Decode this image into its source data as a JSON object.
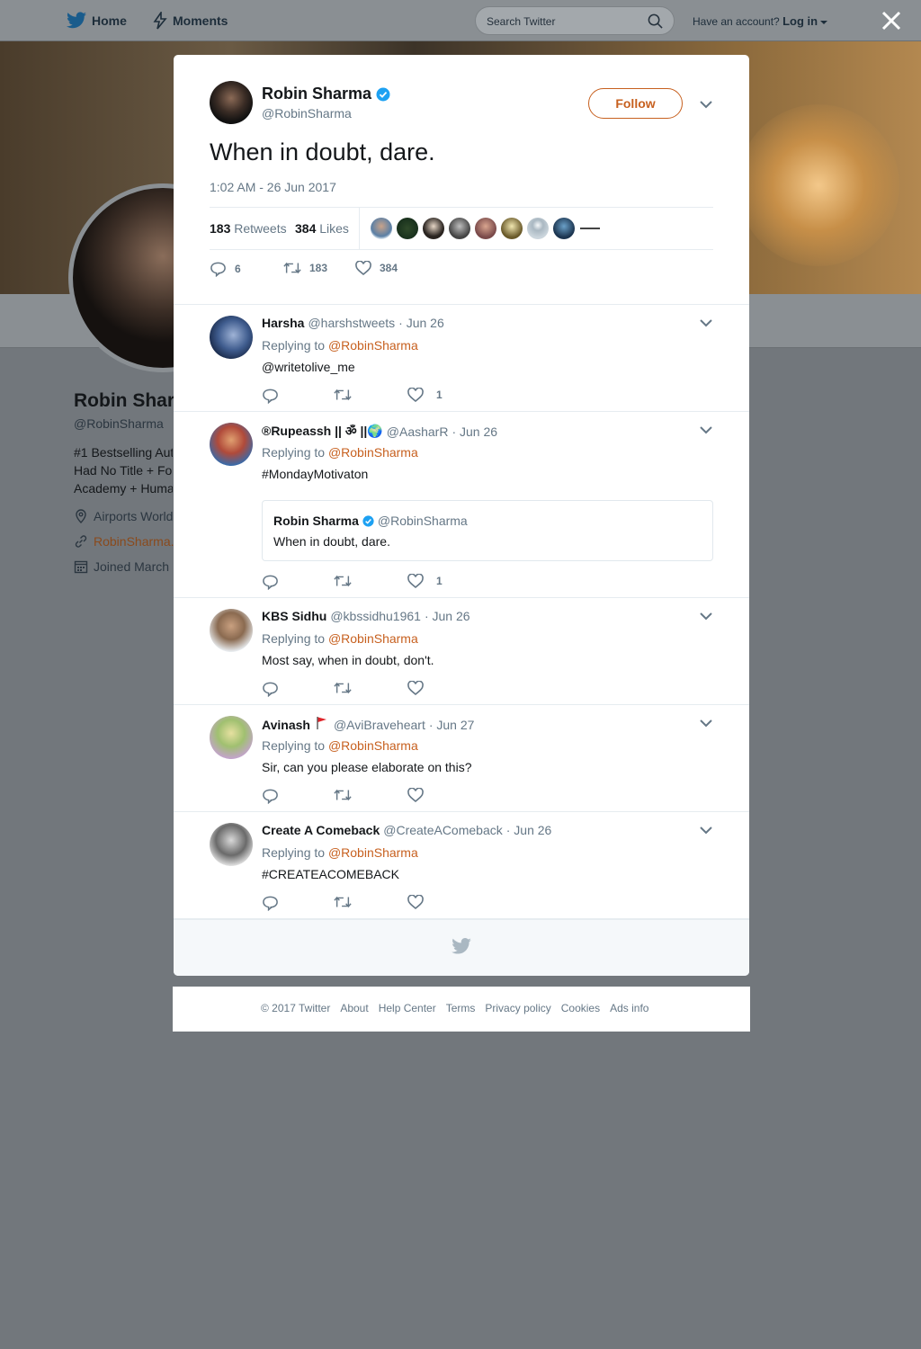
{
  "nav": {
    "home_label": "Home",
    "moments_label": "Moments",
    "search_placeholder": "Search Twitter",
    "have_account": "Have an account?",
    "login_label": "Log in"
  },
  "profile": {
    "name": "Robin Shar",
    "handle": "@RobinSharma",
    "bio_lines": [
      "#1 Bestselling Aut",
      "Had No Title + Fo",
      "Academy + Huma"
    ],
    "location": "Airports World",
    "website": "RobinSharma.",
    "joined": "Joined March"
  },
  "tweet": {
    "author_name": "Robin Sharma",
    "author_handle": "@RobinSharma",
    "follow_label": "Follow",
    "text": "When in doubt, dare.",
    "timestamp": "1:02 AM - 26 Jun 2017",
    "retweets_count": "183",
    "retweets_label": "Retweets",
    "likes_count": "384",
    "likes_label": "Likes",
    "reply_count": "6",
    "retweet_action_count": "183",
    "like_action_count": "384"
  },
  "replies": [
    {
      "name": "Harsha",
      "handle": "@harshstweets",
      "date": "· Jun 26",
      "replying_prefix": "Replying to",
      "replying_to": "@RobinSharma",
      "text": "@writetolive_me",
      "likes": "1"
    },
    {
      "name": "®Rupeassh || ॐ ||🌍",
      "handle": "@AasharR",
      "date": "· Jun 26",
      "replying_prefix": "Replying to",
      "replying_to": "@RobinSharma",
      "text": "#MondayMotivaton",
      "likes": "1",
      "quote": {
        "name": "Robin Sharma",
        "handle": "@RobinSharma",
        "text": "When in doubt, dare."
      }
    },
    {
      "name": "KBS Sidhu",
      "handle": "@kbssidhu1961",
      "date": "· Jun 26",
      "replying_prefix": "Replying to",
      "replying_to": "@RobinSharma",
      "text": "Most say, when in doubt, don't."
    },
    {
      "name": "Avinash",
      "handle": "@AviBraveheart",
      "date": "· Jun 27",
      "replying_prefix": "Replying to",
      "replying_to": "@RobinSharma",
      "text": "Sir, can you please elaborate on this?"
    },
    {
      "name": "Create A Comeback",
      "handle": "@CreateAComeback",
      "date": "· Jun 26",
      "replying_prefix": "Replying to",
      "replying_to": "@RobinSharma",
      "text": "#CREATEACOMEBACK"
    }
  ],
  "footer": {
    "links": [
      "© 2017 Twitter",
      "About",
      "Help Center",
      "Terms",
      "Privacy policy",
      "Cookies",
      "Ads info"
    ]
  },
  "colors": {
    "accent": "#c7601f",
    "verified": "#1da1f2",
    "muted": "#657786"
  }
}
